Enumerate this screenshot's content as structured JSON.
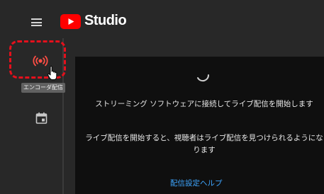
{
  "header": {
    "menu_icon": "hamburger-menu-icon",
    "logo_icon": "youtube-play-logo-icon",
    "brand": "Studio"
  },
  "sidebar": {
    "items": [
      {
        "icon": "live-broadcast-icon",
        "tooltip": "エンコーダ配信",
        "active": true
      },
      {
        "icon": "calendar-icon"
      }
    ]
  },
  "main": {
    "loading_icon": "spinner-icon",
    "message_1": "ストリーミング ソフトウェアに接続してライブ配信を開始します",
    "message_2": "ライブ配信を開始すると、視聴者はライブ配信を見つけられるようになります",
    "help_link": "配信設定ヘルプ"
  },
  "colors": {
    "header_bg": "#282828",
    "panel_bg": "#0f0f0f",
    "youtube_red": "#ff0000",
    "highlight_dashes": "#e5101c",
    "active_icon": "#ff4e45",
    "link": "#3ea6ff"
  }
}
